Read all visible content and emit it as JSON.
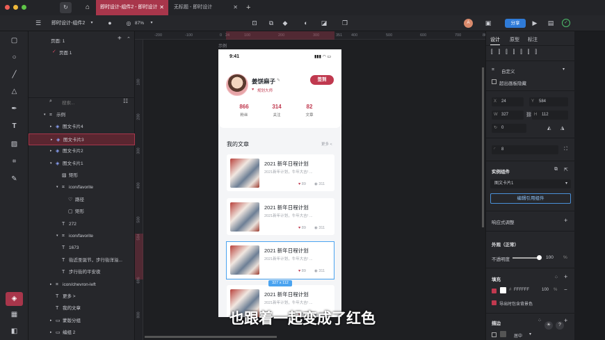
{
  "tabs": [
    {
      "label": "即时设计-组件2 - 即时设计",
      "active": true
    },
    {
      "label": "无标题 - 即时设计",
      "active": false
    }
  ],
  "toolbar": {
    "file_name": "即时设计-组件2",
    "zoom": "87%",
    "share": "分享"
  },
  "layers": {
    "pages_label": "页面: 1",
    "page1": "页面 1",
    "search_placeholder": "搜索...",
    "items": [
      {
        "label": "示例",
        "indent": 0,
        "icon": "frame"
      },
      {
        "label": "图文卡片4",
        "indent": 1,
        "icon": "component"
      },
      {
        "label": "图文卡片3",
        "indent": 1,
        "icon": "component",
        "selected": true
      },
      {
        "label": "图文卡片2",
        "indent": 1,
        "icon": "component"
      },
      {
        "label": "图文卡片1",
        "indent": 1,
        "icon": "component"
      },
      {
        "label": "矩形",
        "indent": 2,
        "icon": "image"
      },
      {
        "label": "icon/favorite",
        "indent": 2,
        "icon": "frame"
      },
      {
        "label": "路径",
        "indent": 3,
        "icon": "heart"
      },
      {
        "label": "矩形",
        "indent": 3,
        "icon": "rect"
      },
      {
        "label": "272",
        "indent": 2,
        "icon": "text"
      },
      {
        "label": "icon/favorite",
        "indent": 2,
        "icon": "frame"
      },
      {
        "label": "1673",
        "indent": 2,
        "icon": "text"
      },
      {
        "label": "街近圣诞节，步行街洋溢...",
        "indent": 2,
        "icon": "text"
      },
      {
        "label": "步行街的平安夜",
        "indent": 2,
        "icon": "text"
      },
      {
        "label": "icon/chevron-left",
        "indent": 1,
        "icon": "frame"
      },
      {
        "label": "更多 >",
        "indent": 1,
        "icon": "text"
      },
      {
        "label": "我的文章",
        "indent": 1,
        "icon": "text"
      },
      {
        "label": "蒙版分组",
        "indent": 1,
        "icon": "folder"
      },
      {
        "label": "编组 2",
        "indent": 1,
        "icon": "folder"
      }
    ]
  },
  "rulers": {
    "h": [
      "-200",
      "-100",
      "0",
      "24",
      "100",
      "200",
      "300",
      "351",
      "400",
      "500",
      "600",
      "700",
      "800"
    ],
    "v": [
      "100",
      "200",
      "300",
      "400",
      "500",
      "584",
      "696",
      "800"
    ]
  },
  "artboard_label": "示例",
  "phone": {
    "time": "9:41",
    "name": "姜饼麻子",
    "badge": "规划大师",
    "signin": "签到",
    "stats": [
      {
        "v": "866",
        "l": "粉丝"
      },
      {
        "v": "314",
        "l": "关注"
      },
      {
        "v": "82",
        "l": "文章"
      }
    ],
    "section": "我的文章",
    "more": "更多 <",
    "cards": [
      {
        "title": "2021 新年日程计划",
        "sub": "2021新年计划，牛年大吉! ...",
        "likes": "89",
        "views": "311"
      },
      {
        "title": "2021 新年日程计划",
        "sub": "2021新年计划，牛年大吉! ...",
        "likes": "89",
        "views": "311"
      },
      {
        "title": "2021 新年日程计划",
        "sub": "2021新年计划，牛年大吉! ...",
        "likes": "89",
        "views": "311"
      },
      {
        "title": "2021 新年日程计划",
        "sub": "2021新年计划，牛年大吉! ...",
        "likes": "89",
        "views": "311"
      }
    ],
    "size_label": "327 x 112"
  },
  "props": {
    "tabs": [
      "设计",
      "原型",
      "标注"
    ],
    "frame_preset": "自定义",
    "clip": "超出画板隐藏",
    "x": "24",
    "y": "584",
    "w": "327",
    "h": "112",
    "rotation": "0",
    "radius": "8",
    "instance_title": "实例组件",
    "instance_name": "图文卡片1",
    "edit_button": "编辑引用组件",
    "responsive": "响应式调整",
    "appearance": "外观（正常）",
    "opacity_label": "不透明度",
    "opacity": "100",
    "opacity_unit": "%",
    "fill_title": "填充",
    "fill_hex": "FFFFFF",
    "fill_opacity": "100",
    "export_bg": "导出时包含背景色",
    "stroke_title": "描边",
    "stroke_pos": "居中"
  },
  "subtitle": "也跟着一起变成了红色",
  "colors": {
    "accent": "#a8364b",
    "share": "#2f7bd8"
  }
}
